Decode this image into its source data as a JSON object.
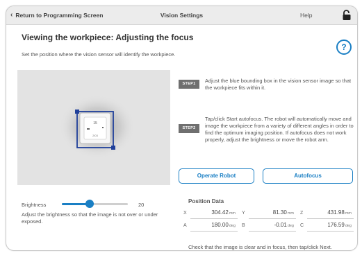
{
  "topbar": {
    "back_label": "Return to Programming Screen",
    "title": "Vision Settings",
    "help_label": "Help"
  },
  "header": {
    "heading": "Viewing the workpiece: Adjusting the focus",
    "subtitle": "Set the position where the vision sensor will identify the workpiece.",
    "help_icon_glyph": "?"
  },
  "image_panel": {
    "workpiece_label_top": "15",
    "workpiece_label_bottom": "2/03"
  },
  "brightness": {
    "label": "Brightness",
    "value": "20",
    "level_fraction": 0.42,
    "hint": "Adjust the brightness so that the image is not over or under exposed."
  },
  "steps": [
    {
      "badge": "STEP1",
      "text": "Adjust the blue bounding box in the vision sensor image so that the workpiece fits within it."
    },
    {
      "badge": "STEP2",
      "text": "Tap/click Start autofocus. The robot will automatically move and image the workpiece from a variety of different angles in order to find the optimum imaging position. If autofocus does not work properly, adjust the brightness or move the robot arm."
    }
  ],
  "buttons": {
    "operate_robot": "Operate Robot",
    "autofocus": "Autofocus"
  },
  "position": {
    "title": "Position Data",
    "rows": [
      [
        {
          "label": "X",
          "value": "304.42",
          "unit": "mm"
        },
        {
          "label": "Y",
          "value": "81.30",
          "unit": "mm"
        },
        {
          "label": "Z",
          "value": "431.98",
          "unit": "mm"
        }
      ],
      [
        {
          "label": "A",
          "value": "180.00",
          "unit": "deg"
        },
        {
          "label": "B",
          "value": "-0.01",
          "unit": "deg"
        },
        {
          "label": "C",
          "value": "176.59",
          "unit": "deg"
        }
      ]
    ]
  },
  "footer": "Check that the image is clear and in focus, then tap/click Next.",
  "colors": {
    "accent": "#1a7fc4",
    "step_badge": "#6f6f6f",
    "topbar": "#ececec"
  },
  "icons": {
    "back": "chevron-left-icon",
    "lock": "lock-icon",
    "help": "question-circle-icon"
  }
}
